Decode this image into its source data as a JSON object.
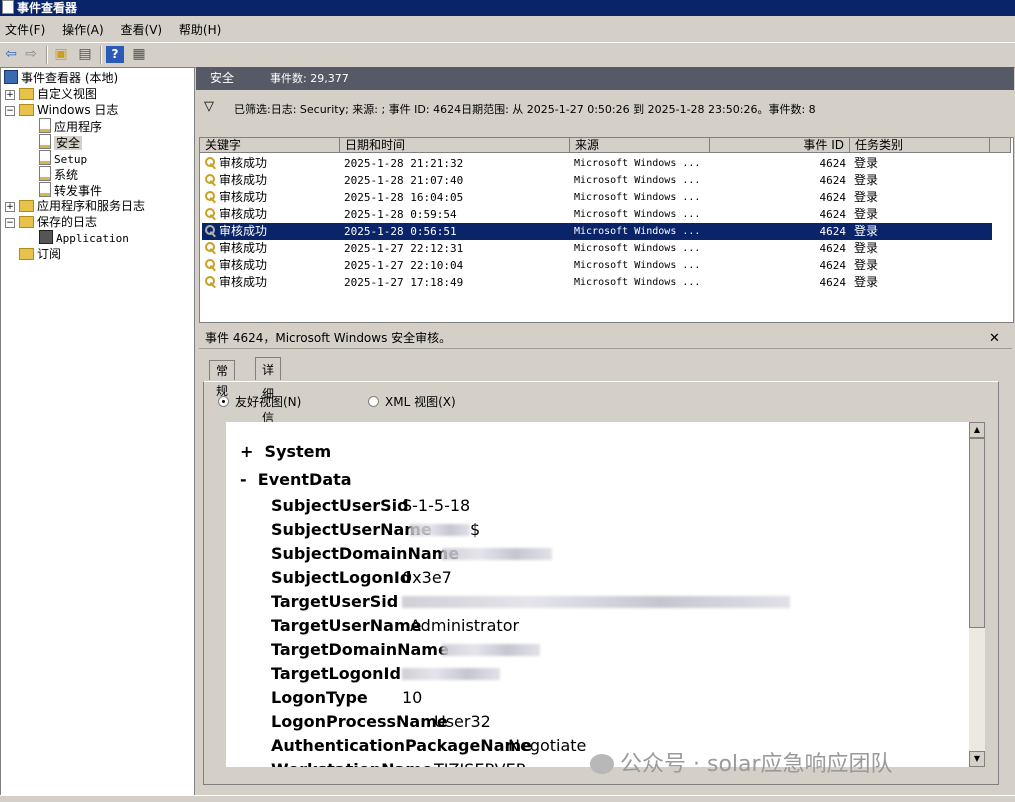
{
  "window": {
    "title": "事件查看器"
  },
  "menu": [
    "文件(F)",
    "操作(A)",
    "查看(V)",
    "帮助(H)"
  ],
  "toolbar_icons": [
    "back-icon",
    "forward-icon",
    "up-folder-icon",
    "show-hide-tree-icon",
    "help-icon",
    "properties-icon"
  ],
  "tree": {
    "root": "事件查看器 (本地)",
    "custom_views": "自定义视图",
    "windows_logs": "Windows 日志",
    "logs": [
      "应用程序",
      "安全",
      "Setup",
      "系统",
      "转发事件"
    ],
    "app_service_logs": "应用程序和服务日志",
    "saved_logs": "保存的日志",
    "saved_items": [
      "Application"
    ],
    "subscriptions": "订阅"
  },
  "panel": {
    "title": "安全",
    "event_count_label": "事件数: 29,377",
    "filter_text": "已筛选:日志: Security; 来源: ; 事件 ID: 4624日期范围: 从 2025-1-27 0:50:26 到 2025-1-28 23:50:26。事件数: 8"
  },
  "columns": [
    "关键字",
    "日期和时间",
    "来源",
    "事件 ID",
    "任务类别"
  ],
  "events": [
    {
      "keyword": "审核成功",
      "datetime": "2025-1-28 21:21:32",
      "source": "Microsoft Windows ...",
      "id": "4624",
      "category": "登录"
    },
    {
      "keyword": "审核成功",
      "datetime": "2025-1-28 21:07:40",
      "source": "Microsoft Windows ...",
      "id": "4624",
      "category": "登录"
    },
    {
      "keyword": "审核成功",
      "datetime": "2025-1-28 16:04:05",
      "source": "Microsoft Windows ...",
      "id": "4624",
      "category": "登录"
    },
    {
      "keyword": "审核成功",
      "datetime": "2025-1-28 0:59:54",
      "source": "Microsoft Windows ...",
      "id": "4624",
      "category": "登录"
    },
    {
      "keyword": "审核成功",
      "datetime": "2025-1-28 0:56:51",
      "source": "Microsoft Windows ...",
      "id": "4624",
      "category": "登录"
    },
    {
      "keyword": "审核成功",
      "datetime": "2025-1-27 22:12:31",
      "source": "Microsoft Windows ...",
      "id": "4624",
      "category": "登录"
    },
    {
      "keyword": "审核成功",
      "datetime": "2025-1-27 22:10:04",
      "source": "Microsoft Windows ...",
      "id": "4624",
      "category": "登录"
    },
    {
      "keyword": "审核成功",
      "datetime": "2025-1-27 17:18:49",
      "source": "Microsoft Windows ...",
      "id": "4624",
      "category": "登录"
    }
  ],
  "selected_event_index": 4,
  "detail": {
    "title": "事件 4624，Microsoft Windows 安全审核。",
    "tabs": [
      "常规",
      "详细信息"
    ],
    "active_tab": 1,
    "radio_friendly": "友好视图(N)",
    "radio_xml": "XML 视图(X)",
    "sections": {
      "system": "System",
      "eventdata": "EventData",
      "plus": "+",
      "minus": "-"
    },
    "fields": [
      {
        "name": "SubjectUserSid",
        "value": "S-1-5-18"
      },
      {
        "name": "SubjectUserName",
        "value": "$"
      },
      {
        "name": "SubjectDomainName",
        "value": ""
      },
      {
        "name": "SubjectLogonId",
        "value": "0x3e7"
      },
      {
        "name": "TargetUserSid",
        "value": ""
      },
      {
        "name": "TargetUserName",
        "value": "Administrator"
      },
      {
        "name": "TargetDomainName",
        "value": ""
      },
      {
        "name": "TargetLogonId",
        "value": ""
      },
      {
        "name": "LogonType",
        "value": "10"
      },
      {
        "name": "LogonProcessName",
        "value": "User32"
      },
      {
        "name": "AuthenticationPackageName",
        "value": "Negotiate"
      },
      {
        "name": "WorkstationName",
        "value": "TIZISERVER"
      }
    ]
  },
  "watermark": "公众号 · solar应急响应团队"
}
